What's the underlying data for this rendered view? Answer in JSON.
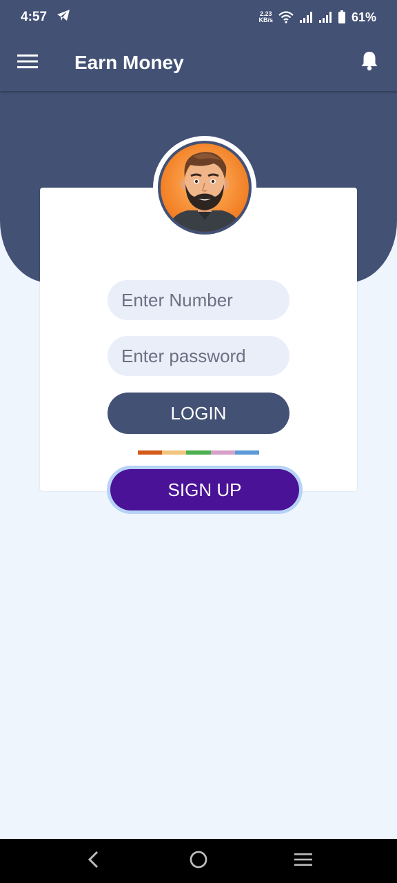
{
  "status_bar": {
    "time": "4:57",
    "net_speed_value": "2.23",
    "net_speed_unit": "KB/s",
    "battery": "61%"
  },
  "app_bar": {
    "title": "Earn Money"
  },
  "login_form": {
    "number_placeholder": "Enter Number",
    "password_placeholder": "Enter password",
    "login_label": "LOGIN",
    "signup_label": "SIGN UP"
  },
  "colors": {
    "primary": "#435175",
    "signup": "#4a1296",
    "background": "#eef5fd",
    "divider": [
      "#d35a18",
      "#f2c57e",
      "#4caf50",
      "#d6a0c8",
      "#5b9bd8"
    ]
  },
  "icons": {
    "menu": "hamburger-icon",
    "notification": "bell-icon",
    "telegram": "telegram-icon",
    "wifi": "wifi-icon",
    "signal": "signal-icon",
    "battery": "battery-icon",
    "back": "back-icon",
    "home": "home-icon",
    "recents": "recents-icon"
  }
}
